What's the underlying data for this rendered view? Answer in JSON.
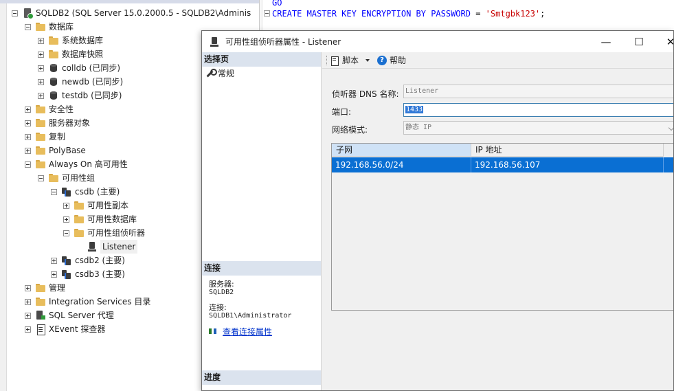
{
  "object_explorer": {
    "server": "SQLDB2 (SQL Server 15.0.2000.5 - SQLDB2\\Adminis",
    "nodes": {
      "databases": "数据库",
      "system_dbs": "系统数据库",
      "db_snapshots": "数据库快照",
      "colldb": "colldb (已同步)",
      "newdb": "newdb (已同步)",
      "testdb": "testdb (已同步)",
      "security": "安全性",
      "server_objects": "服务器对象",
      "replication": "复制",
      "polybase": "PolyBase",
      "always_on": "Always On 高可用性",
      "availability_groups": "可用性组",
      "csdb": "csdb (主要)",
      "replicas": "可用性副本",
      "ag_databases": "可用性数据库",
      "ag_listeners": "可用性组侦听器",
      "listener": "Listener",
      "csdb2": "csdb2 (主要)",
      "csdb3": "csdb3 (主要)",
      "management": "管理",
      "integration_services": "Integration Services 目录",
      "sql_agent": "SQL Server 代理",
      "xevent": "XEvent 探查器"
    }
  },
  "editor": {
    "line1": "GO",
    "line2_kw": "CREATE MASTER KEY ENCRYPTION BY PASSWORD",
    "line2_eq": " = ",
    "line2_str": "'Smtgbk123'",
    "line2_end": ";"
  },
  "dialog": {
    "title": "可用性组侦听器属性 - Listener",
    "minimize": "—",
    "maximize": "☐",
    "close": "✕",
    "select_page_header": "选择页",
    "page_general": "常规",
    "connection_header": "连接",
    "server_label": "服务器:",
    "server_value": "SQLDB2",
    "connection_label": "连接:",
    "connection_value": "SQLDB1\\Administrator",
    "view_conn_props": "查看连接属性",
    "progress_header": "进度",
    "toolbar": {
      "script": "脚本",
      "help": "帮助"
    },
    "form": {
      "dns_label": "侦听器 DNS 名称:",
      "dns_value": "Listener",
      "port_label": "端口:",
      "port_value": "1433",
      "network_label": "网络模式:",
      "network_value": "静态 IP"
    },
    "grid": {
      "columns": [
        "子网",
        "IP 地址"
      ],
      "rows": [
        {
          "subnet": "192.168.56.0/24",
          "ip": "192.168.56.107"
        }
      ]
    }
  }
}
